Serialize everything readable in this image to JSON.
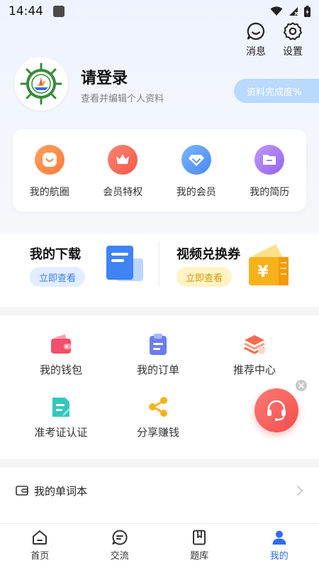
{
  "status_bar": {
    "time": "14:44"
  },
  "header": {
    "messages_label": "消息",
    "settings_label": "设置"
  },
  "profile": {
    "login_title": "请登录",
    "login_subtitle": "查看并编辑个人资料",
    "completion_label": "资料完成度%"
  },
  "quick_actions": [
    {
      "label": "我的航圈",
      "icon": "smile-icon",
      "color": "#ff8a4c"
    },
    {
      "label": "会员特权",
      "icon": "crown-icon",
      "color": "#ff6b57"
    },
    {
      "label": "我的会员",
      "icon": "diamond-icon",
      "color": "#5b9cf5"
    },
    {
      "label": "我的简历",
      "icon": "folder-icon",
      "color": "#a97cf0"
    }
  ],
  "promos": {
    "downloads": {
      "title": "我的下载",
      "button": "立即查看",
      "icon": "document-icon"
    },
    "video_coupon": {
      "title": "视频兑换券",
      "button": "立即查看",
      "icon": "ticket-icon"
    }
  },
  "services": [
    {
      "label": "我的钱包",
      "icon": "wallet-icon",
      "color": "#f0506b"
    },
    {
      "label": "我的订单",
      "icon": "clipboard-icon",
      "color": "#6c7cf0"
    },
    {
      "label": "推荐中心",
      "icon": "layers-icon",
      "color": "#f26b4f"
    },
    {
      "label": "准考证认证",
      "icon": "certificate-icon",
      "color": "#35c6c0"
    },
    {
      "label": "分享赚钱",
      "icon": "share-icon",
      "color": "#f7b21b"
    }
  ],
  "list": {
    "word_book_label": "我的单词本"
  },
  "bottom_nav": [
    {
      "label": "首页",
      "icon": "home-icon"
    },
    {
      "label": "交流",
      "icon": "chat-icon"
    },
    {
      "label": "题库",
      "icon": "book-icon"
    },
    {
      "label": "我的",
      "icon": "user-icon",
      "active": true
    }
  ],
  "colors": {
    "accent": "#2f6bf5",
    "pill": "#b9d9ff",
    "support": "#f04e4a"
  }
}
